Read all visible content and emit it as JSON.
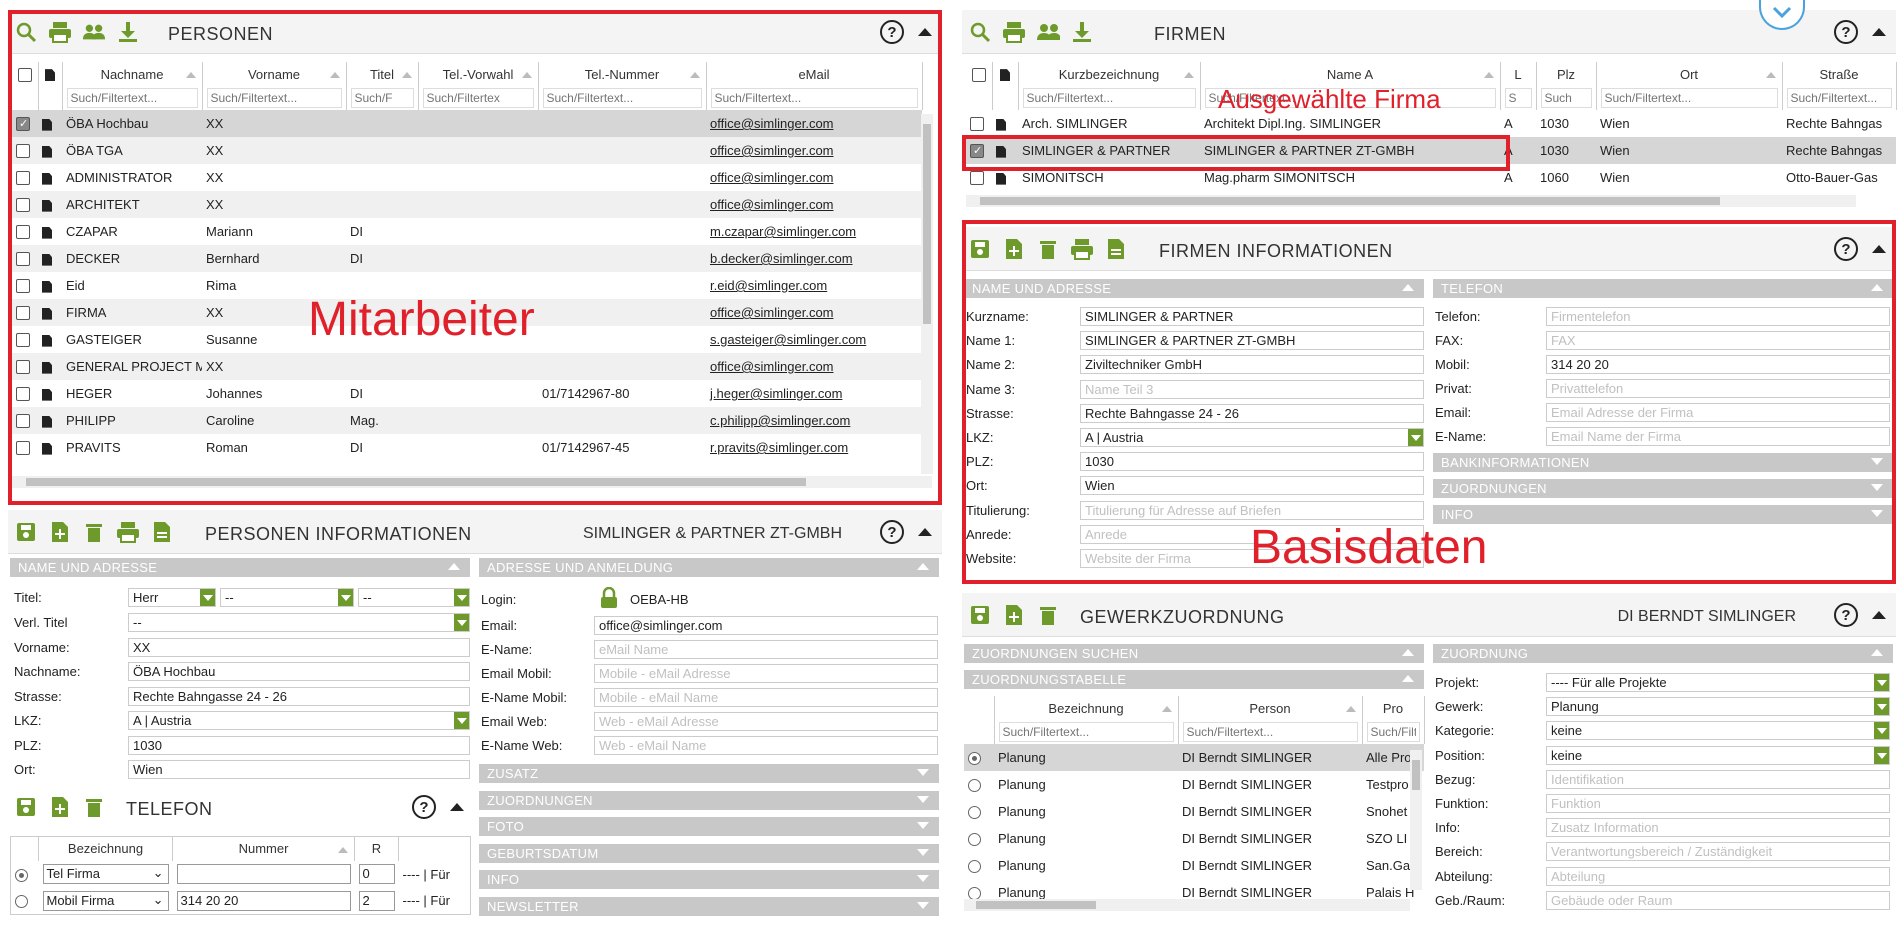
{
  "persons": {
    "title": "PERSONEN",
    "columns": [
      "Nachname",
      "Vorname",
      "Titel",
      "Tel.-Vorwahl",
      "Tel.-Nummer",
      "eMail"
    ],
    "filter_placeholders": [
      "Such/Filtertext...",
      "Such/Filtertext...",
      "Such/F",
      "Such/Filtertex",
      "Such/Filtertext...",
      "Such/Filtertext..."
    ],
    "rows": [
      {
        "checked": true,
        "nachname": "ÖBA Hochbau",
        "vorname": "XX",
        "titel": "",
        "vorwahl": "",
        "nummer": "",
        "email": "office@simlinger.com"
      },
      {
        "checked": false,
        "nachname": "ÖBA TGA",
        "vorname": "XX",
        "titel": "",
        "vorwahl": "",
        "nummer": "",
        "email": "office@simlinger.com"
      },
      {
        "checked": false,
        "nachname": "ADMINISTRATOR",
        "vorname": "XX",
        "titel": "",
        "vorwahl": "",
        "nummer": "",
        "email": "office@simlinger.com"
      },
      {
        "checked": false,
        "nachname": "ARCHITEKT",
        "vorname": "XX",
        "titel": "",
        "vorwahl": "",
        "nummer": "",
        "email": "office@simlinger.com"
      },
      {
        "checked": false,
        "nachname": "CZAPAR",
        "vorname": "Mariann",
        "titel": "DI",
        "vorwahl": "",
        "nummer": "",
        "email": "m.czapar@simlinger.com"
      },
      {
        "checked": false,
        "nachname": "DECKER",
        "vorname": "Bernhard",
        "titel": "DI",
        "vorwahl": "",
        "nummer": "",
        "email": "b.decker@simlinger.com"
      },
      {
        "checked": false,
        "nachname": "Eid",
        "vorname": "Rima",
        "titel": "",
        "vorwahl": "",
        "nummer": "",
        "email": "r.eid@simlinger.com"
      },
      {
        "checked": false,
        "nachname": "FIRMA",
        "vorname": "XX",
        "titel": "",
        "vorwahl": "",
        "nummer": "",
        "email": "office@simlinger.com"
      },
      {
        "checked": false,
        "nachname": "GASTEIGER",
        "vorname": "Susanne",
        "titel": "",
        "vorwahl": "",
        "nummer": "",
        "email": "s.gasteiger@simlinger.com"
      },
      {
        "checked": false,
        "nachname": "GENERAL PROJECT M",
        "vorname": "XX",
        "titel": "",
        "vorwahl": "",
        "nummer": "",
        "email": "office@simlinger.com"
      },
      {
        "checked": false,
        "nachname": "HEGER",
        "vorname": "Johannes",
        "titel": "DI",
        "vorwahl": "",
        "nummer": "01/7142967-80",
        "email": "j.heger@simlinger.com"
      },
      {
        "checked": false,
        "nachname": "PHILIPP",
        "vorname": "Caroline",
        "titel": "Mag.",
        "vorwahl": "",
        "nummer": "",
        "email": "c.philipp@simlinger.com"
      },
      {
        "checked": false,
        "nachname": "PRAVITS",
        "vorname": "Roman",
        "titel": "DI",
        "vorwahl": "",
        "nummer": "01/7142967-45",
        "email": "r.pravits@simlinger.com"
      }
    ],
    "annotation": "Mitarbeiter"
  },
  "firms": {
    "title": "FIRMEN",
    "columns": [
      "Kurzbezeichnung",
      "Name A",
      "L",
      "Plz",
      "Ort",
      "Straße"
    ],
    "filter_placeholders": [
      "Such/Filtertext...",
      "Such/Filtertext...",
      "S",
      "Such",
      "Such/Filtertext...",
      "Such/Filtertext..."
    ],
    "rows": [
      {
        "checked": false,
        "kurz": "Arch. SIMLINGER",
        "name": "Architekt Dipl.Ing. SIMLINGER",
        "l": "A",
        "plz": "1030",
        "ort": "Wien",
        "strasse": "Rechte Bahngas"
      },
      {
        "checked": true,
        "kurz": "SIMLINGER & PARTNER",
        "name": "SIMLINGER & PARTNER ZT-GMBH",
        "l": "A",
        "plz": "1030",
        "ort": "Wien",
        "strasse": "Rechte Bahngas"
      },
      {
        "checked": false,
        "kurz": "SIMONITSCH",
        "name": "Mag.pharm SIMONITSCH",
        "l": "A",
        "plz": "1060",
        "ort": "Wien",
        "strasse": "Otto-Bauer-Gas"
      }
    ],
    "annotation": "Ausgewählte Firma"
  },
  "firm_info": {
    "title": "FIRMEN INFORMATIONEN",
    "section_name": "NAME UND ADRESSE",
    "section_phone": "TELEFON",
    "fields": [
      {
        "label": "Kurzname:",
        "value": "SIMLINGER & PARTNER",
        "ph": false
      },
      {
        "label": "Name 1:",
        "value": "SIMLINGER & PARTNER ZT-GMBH",
        "ph": false
      },
      {
        "label": "Name 2:",
        "value": "Ziviltechniker GmbH",
        "ph": false
      },
      {
        "label": "Name 3:",
        "value": "Name Teil 3",
        "ph": true
      },
      {
        "label": "Strasse:",
        "value": "Rechte Bahngasse 24 - 26",
        "ph": false
      },
      {
        "label": "LKZ:",
        "value": "A | Austria",
        "ph": false
      },
      {
        "label": "PLZ:",
        "value": "1030",
        "ph": false
      },
      {
        "label": "Ort:",
        "value": "Wien",
        "ph": false
      },
      {
        "label": "Titulierung:",
        "value": "Titulierung für Adresse auf Briefen",
        "ph": true
      },
      {
        "label": "Anrede:",
        "value": "Anrede",
        "ph": true
      },
      {
        "label": "Website:",
        "value": "Website der Firma",
        "ph": true
      }
    ],
    "phone_fields": [
      {
        "label": "Telefon:",
        "value": "Firmentelefon",
        "ph": true
      },
      {
        "label": "FAX:",
        "value": "FAX",
        "ph": true
      },
      {
        "label": "Mobil:",
        "value": "314 20 20",
        "ph": false
      },
      {
        "label": "Privat:",
        "value": "Privattelefon",
        "ph": true
      },
      {
        "label": "Email:",
        "value": "Email Adresse der Firma",
        "ph": true
      },
      {
        "label": "E-Name:",
        "value": "Email Name der Firma",
        "ph": true
      }
    ],
    "collapsed_sections": [
      "BANKINFORMATIONEN",
      "ZUORDNUNGEN",
      "INFO"
    ],
    "annotation": "Basisdaten"
  },
  "person_info": {
    "title": "PERSONEN INFORMATIONEN",
    "subtitle": "SIMLINGER & PARTNER ZT-GMBH",
    "section_name": "NAME UND ADRESSE",
    "section_login": "ADRESSE UND ANMELDUNG",
    "titel_label": "Titel:",
    "titel_values": [
      "Herr",
      "--",
      "--"
    ],
    "fields": [
      {
        "label": "Verl. Titel",
        "value": "--",
        "dd": true
      },
      {
        "label": "Vorname:",
        "value": "XX",
        "dd": false
      },
      {
        "label": "Nachname:",
        "value": "ÖBA Hochbau",
        "dd": false
      },
      {
        "label": "Strasse:",
        "value": "Rechte Bahngasse 24 - 26",
        "dd": false
      },
      {
        "label": "LKZ:",
        "value": "A | Austria",
        "dd": true
      },
      {
        "label": "PLZ:",
        "value": "1030",
        "dd": false
      },
      {
        "label": "Ort:",
        "value": "Wien",
        "dd": false
      }
    ],
    "login_label": "Login:",
    "login_value": "OEBA-HB",
    "login_fields": [
      {
        "label": "Email:",
        "value": "office@simlinger.com",
        "ph": false
      },
      {
        "label": "E-Name:",
        "value": "eMail Name",
        "ph": true
      },
      {
        "label": "Email Mobil:",
        "value": "Mobile - eMail Adresse",
        "ph": true
      },
      {
        "label": "E-Name Mobil:",
        "value": "Mobile - eMail Name",
        "ph": true
      },
      {
        "label": "Email Web:",
        "value": "Web - eMail Adresse",
        "ph": true
      },
      {
        "label": "E-Name Web:",
        "value": "Web - eMail Name",
        "ph": true
      }
    ],
    "collapsed_sections": [
      "ZUSATZ",
      "ZUORDNUNGEN",
      "FOTO",
      "GEBURTSDATUM",
      "INFO",
      "NEWSLETTER"
    ]
  },
  "phone": {
    "title": "TELEFON",
    "columns": [
      "Bezeichnung",
      "Nummer",
      "R"
    ],
    "rows": [
      {
        "selected": true,
        "bez": "Tel Firma",
        "nummer": "",
        "r": "0",
        "extra": "---- | Für"
      },
      {
        "selected": false,
        "bez": "Mobil Firma",
        "nummer": "314 20 20",
        "r": "2",
        "extra": "---- | Für"
      }
    ]
  },
  "gewerk": {
    "title": "GEWERKZUORDNUNG",
    "subtitle": "DI BERNDT SIMLINGER",
    "section_search": "ZUORDNUNGEN SUCHEN",
    "section_table": "ZUORDNUNGSTABELLE",
    "columns": [
      "Bezeichnung",
      "Person",
      "Pro"
    ],
    "filter_placeholders": [
      "Such/Filtertext...",
      "Such/Filtertext...",
      "Such/Filt"
    ],
    "rows": [
      {
        "selected": true,
        "bez": "Planung",
        "person": "DI Berndt SIMLINGER",
        "pro": "Alle Pro"
      },
      {
        "selected": false,
        "bez": "Planung",
        "person": "DI Berndt SIMLINGER",
        "pro": "Testpro"
      },
      {
        "selected": false,
        "bez": "Planung",
        "person": "DI Berndt SIMLINGER",
        "pro": "Snohet"
      },
      {
        "selected": false,
        "bez": "Planung",
        "person": "DI Berndt SIMLINGER",
        "pro": "SZO LI"
      },
      {
        "selected": false,
        "bez": "Planung",
        "person": "DI Berndt SIMLINGER",
        "pro": "San.Ga"
      },
      {
        "selected": false,
        "bez": "Planung",
        "person": "DI Berndt SIMLINGER",
        "pro": "Palais H"
      }
    ],
    "section_zuord": "ZUORDNUNG",
    "zuord_fields": [
      {
        "label": "Projekt:",
        "value": "---- Für alle Projekte",
        "ph": false,
        "dd": true
      },
      {
        "label": "Gewerk:",
        "value": "Planung",
        "ph": false,
        "dd": true
      },
      {
        "label": "Kategorie:",
        "value": "keine",
        "ph": false,
        "dd": true
      },
      {
        "label": "Position:",
        "value": "keine",
        "ph": false,
        "dd": true
      },
      {
        "label": "Bezug:",
        "value": "Identifikation",
        "ph": true,
        "dd": false
      },
      {
        "label": "Funktion:",
        "value": "Funktion",
        "ph": true,
        "dd": false
      },
      {
        "label": "Info:",
        "value": "Zusatz Information",
        "ph": true,
        "dd": false
      },
      {
        "label": "Bereich:",
        "value": "Verantwortungsbereich / Zuständigkeit",
        "ph": true,
        "dd": false
      },
      {
        "label": "Abteilung:",
        "value": "Abteilung",
        "ph": true,
        "dd": false
      },
      {
        "label": "Geb./Raum:",
        "value": "Gebäude oder Raum",
        "ph": true,
        "dd": false
      }
    ]
  },
  "colors": {
    "accent_green": "#6e9a2c",
    "annotation_red": "#e0202a",
    "section_grey": "#c8c8c8"
  }
}
